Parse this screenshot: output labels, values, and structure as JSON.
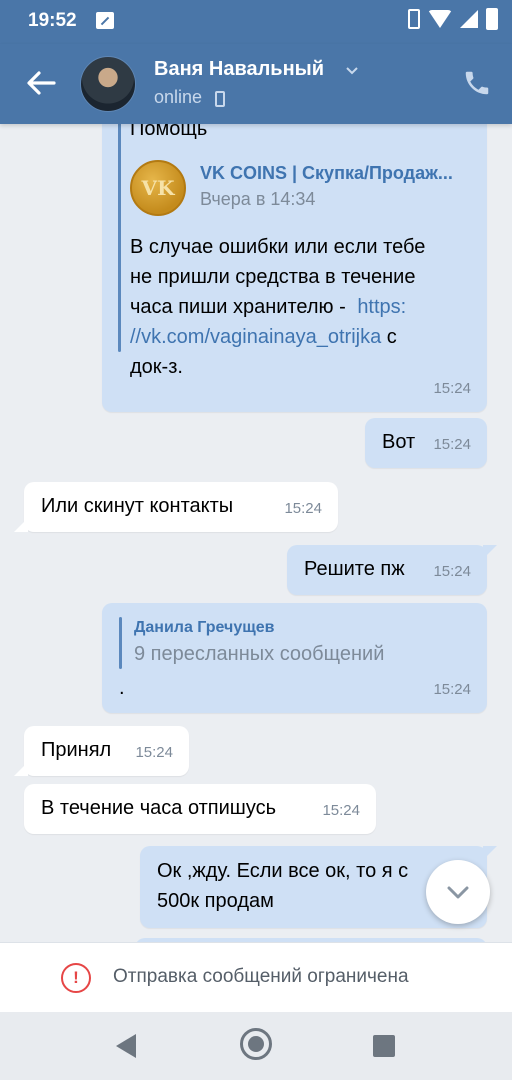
{
  "status_bar": {
    "time": "19:52"
  },
  "header": {
    "contact_name": "Ваня Навальный",
    "status": "online"
  },
  "messages": [
    {
      "direction": "out",
      "quote_title": "Помощь",
      "post_author": "VK COINS | Скупка/Продаж...",
      "post_date": "Вчера в 14:34",
      "post_avatar_text": "VK",
      "text_lines": [
        "В случае ошибки или если тебе",
        "не пришли средства в течение",
        "часа пиши хранителю -"
      ],
      "link_part1": "https:",
      "link_part2": "//vk.com/vaginainaya_otrijka",
      "after_link": "с",
      "last_line": "док-з.",
      "time": "15:24"
    },
    {
      "direction": "out",
      "text": "Вот",
      "time": "15:24"
    },
    {
      "direction": "in",
      "text": "Или скинут контакты",
      "time": "15:24"
    },
    {
      "direction": "out",
      "text": "Решите пж",
      "time": "15:24"
    },
    {
      "direction": "out",
      "forward_author": "Данила Гречущев",
      "forward_summary": "9 пересланных сообщений",
      "text": ".",
      "time": "15:24"
    },
    {
      "direction": "in",
      "text": "Принял",
      "time": "15:24"
    },
    {
      "direction": "in",
      "text": "В течение часа отпишусь",
      "time": "15:24"
    },
    {
      "direction": "out",
      "line1": "Ок ,жду. Если все ок, то я с",
      "line2": "500к продам"
    }
  ],
  "composer": {
    "restricted_text": "Отправка сообщений ограничена"
  },
  "colors": {
    "header": "#4a76a8",
    "outgoing_bubble": "#cfe0f5",
    "incoming_bubble": "#ffffff",
    "warning": "#e64646"
  },
  "icons": [
    "back-arrow-icon",
    "chevron-down-icon",
    "mobile-icon",
    "phone-icon",
    "chevron-down-icon",
    "warning-icon",
    "nav-back-icon",
    "nav-home-icon",
    "nav-recent-icon"
  ]
}
